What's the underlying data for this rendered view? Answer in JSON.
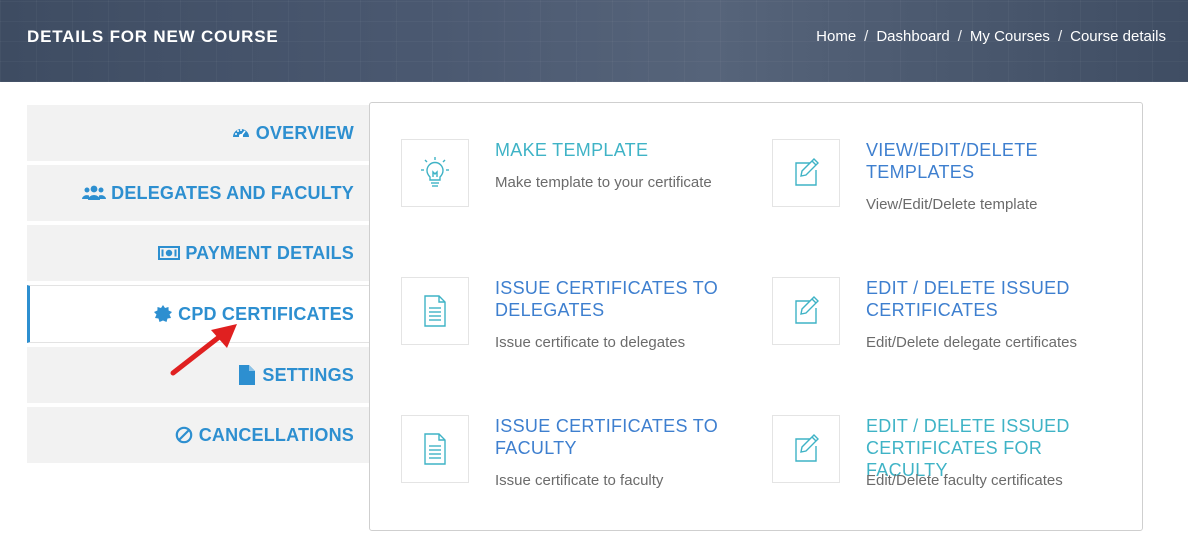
{
  "header": {
    "title": "DETAILS FOR NEW COURSE",
    "breadcrumb": [
      "Home",
      "Dashboard",
      "My Courses",
      "Course details"
    ],
    "separator": "/"
  },
  "sidebar": {
    "items": [
      {
        "label": "OVERVIEW",
        "icon": "dashboard-icon"
      },
      {
        "label": "DELEGATES AND FACULTY",
        "icon": "users-icon"
      },
      {
        "label": "PAYMENT DETAILS",
        "icon": "money-icon"
      },
      {
        "label": "CPD CERTIFICATES",
        "icon": "certificate-icon",
        "active": true
      },
      {
        "label": "SETTINGS",
        "icon": "file-icon"
      },
      {
        "label": "CANCELLATIONS",
        "icon": "ban-icon"
      }
    ]
  },
  "cards": [
    {
      "title": "MAKE TEMPLATE",
      "desc": "Make template to your certificate",
      "icon": "lightbulb-icon",
      "title_color": "teal"
    },
    {
      "title": "VIEW/EDIT/DELETE TEMPLATES",
      "desc": "View/Edit/Delete template",
      "icon": "edit-icon",
      "title_color": "blue"
    },
    {
      "title": "ISSUE CERTIFICATES TO DELEGATES",
      "desc": "Issue certificate to delegates",
      "icon": "document-icon",
      "title_color": "blue"
    },
    {
      "title": "EDIT / DELETE ISSUED CERTIFICATES",
      "desc": "Edit/Delete delegate certificates",
      "icon": "edit-icon",
      "title_color": "blue"
    },
    {
      "title": "ISSUE CERTIFICATES TO FACULTY",
      "desc": "Issue certificate to faculty",
      "icon": "document-icon",
      "title_color": "blue"
    },
    {
      "title": "EDIT / DELETE ISSUED CERTIFICATES FOR FACULTY",
      "desc": "Edit/Delete faculty certificates",
      "icon": "edit-icon",
      "title_color": "teal"
    }
  ],
  "colors": {
    "accent_blue": "#2d8fd0",
    "title_blue": "#3e7fcf",
    "teal": "#3fb3c6",
    "annotation_arrow": "#e02020"
  }
}
